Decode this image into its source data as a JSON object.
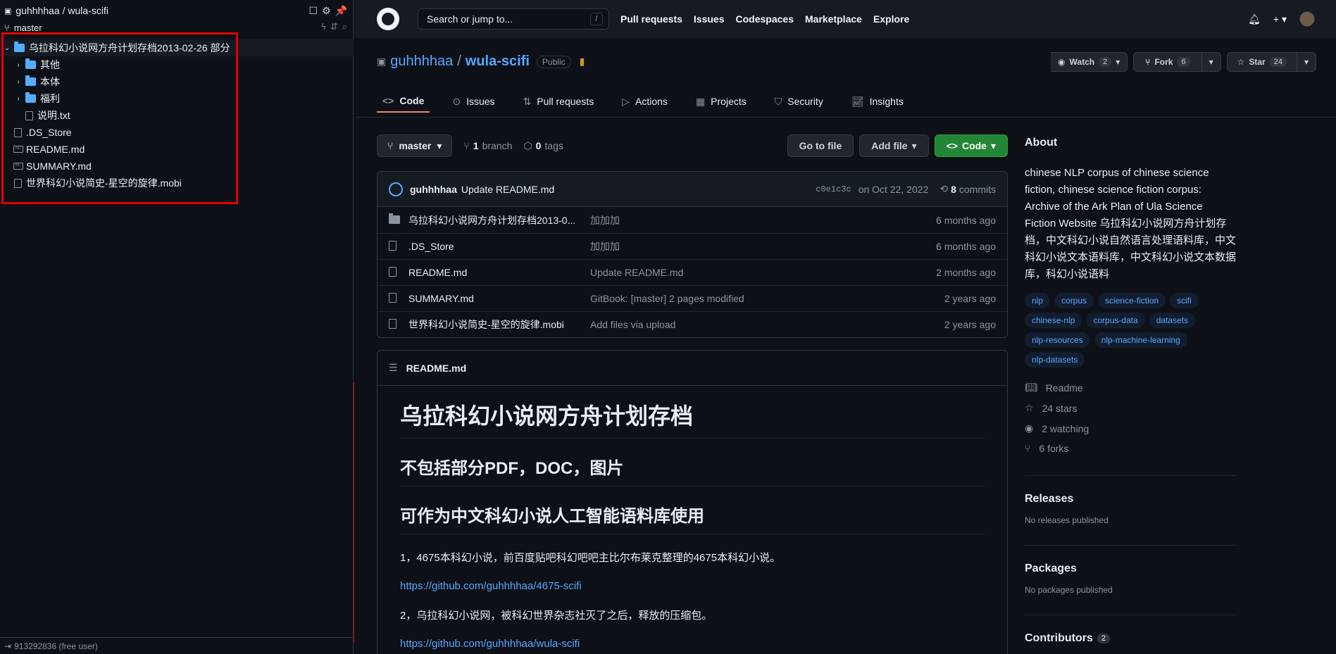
{
  "sidebar": {
    "repo": "guhhhhaa / wula-scifi",
    "branch": "master",
    "tree": [
      {
        "label": "乌拉科幻小说网方舟计划存档2013-02-26 部分",
        "type": "folder",
        "expanded": true,
        "depth": 0
      },
      {
        "label": "其他",
        "type": "folder",
        "expanded": false,
        "depth": 1
      },
      {
        "label": "本体",
        "type": "folder",
        "expanded": false,
        "depth": 1
      },
      {
        "label": "福利",
        "type": "folder",
        "expanded": false,
        "depth": 1
      },
      {
        "label": "说明.txt",
        "type": "file",
        "depth": 1
      },
      {
        "label": ".DS_Store",
        "type": "file",
        "depth": 0
      },
      {
        "label": "README.md",
        "type": "md",
        "depth": 0
      },
      {
        "label": "SUMMARY.md",
        "type": "md",
        "depth": 0
      },
      {
        "label": "世界科幻小说简史-星空的旋律.mobi",
        "type": "file",
        "depth": 0
      }
    ],
    "footer_user": "913292836 (free user)"
  },
  "header": {
    "search_placeholder": "Search or jump to...",
    "search_key": "/",
    "nav": [
      "Pull requests",
      "Issues",
      "Codespaces",
      "Marketplace",
      "Explore"
    ]
  },
  "repo": {
    "owner": "guhhhhaa",
    "separator": "/",
    "name": "wula-scifi",
    "visibility": "Public",
    "watch_label": "Watch",
    "watch_count": "2",
    "fork_label": "Fork",
    "fork_count": "6",
    "star_label": "Star",
    "star_count": "24"
  },
  "tabs": [
    "Code",
    "Issues",
    "Pull requests",
    "Actions",
    "Projects",
    "Security",
    "Insights"
  ],
  "toolbar": {
    "branch": "master",
    "branch_count": "1",
    "branch_word": "branch",
    "tag_count": "0",
    "tag_word": "tags",
    "go_to_file": "Go to file",
    "add_file": "Add file",
    "code": "Code"
  },
  "commit": {
    "author": "guhhhhaa",
    "message": "Update README.md",
    "sha": "c0e1c3c",
    "date": "on Oct 22, 2022",
    "count": "8",
    "count_word": "commits"
  },
  "files": [
    {
      "name": "乌拉科幻小说网方舟计划存档2013-0...",
      "type": "dir",
      "message": "加加加",
      "age": "6 months ago"
    },
    {
      "name": ".DS_Store",
      "type": "file",
      "message": "加加加",
      "age": "6 months ago"
    },
    {
      "name": "README.md",
      "type": "file",
      "message": "Update README.md",
      "age": "2 months ago"
    },
    {
      "name": "SUMMARY.md",
      "type": "file",
      "message": "GitBook: [master] 2 pages modified",
      "age": "2 years ago"
    },
    {
      "name": "世界科幻小说简史-星空的旋律.mobi",
      "type": "file",
      "message": "Add files via upload",
      "age": "2 years ago"
    }
  ],
  "readme": {
    "filename": "README.md",
    "h1": "乌拉科幻小说网方舟计划存档",
    "h2a": "不包括部分PDF，DOC，图片",
    "h2b": "可作为中文科幻小说人工智能语料库使用",
    "p1": "1，4675本科幻小说，前百度贴吧科幻吧吧主比尔布莱克整理的4675本科幻小说。",
    "link1": "https://github.com/guhhhhaa/4675-scifi",
    "p2": "2，乌拉科幻小说网，被科幻世界杂志社灭了之后，释放的压缩包。",
    "link2": "https://github.com/guhhhhaa/wula-scifi"
  },
  "about": {
    "title": "About",
    "description": "chinese NLP corpus of chinese science fiction, chinese science fiction corpus: Archive of the Ark Plan of Ula Science Fiction Website 乌拉科幻小说网方舟计划存档，中文科幻小说自然语言处理语料库，中文科幻小说文本语料库，中文科幻小说文本数据库，科幻小说语料",
    "topics": [
      "nlp",
      "corpus",
      "science-fiction",
      "scifi",
      "chinese-nlp",
      "corpus-data",
      "datasets",
      "nlp-resources",
      "nlp-machine-learning",
      "nlp-datasets"
    ],
    "readme": "Readme",
    "stars": "24 stars",
    "watching": "2 watching",
    "forks": "6 forks",
    "releases_title": "Releases",
    "releases_sub": "No releases published",
    "packages_title": "Packages",
    "packages_sub": "No packages published",
    "contributors_title": "Contributors",
    "contributors_count": "2"
  },
  "colors": {
    "accent": "#58a6ff",
    "highlight_box": "#e40000",
    "code_button": "#238636"
  }
}
